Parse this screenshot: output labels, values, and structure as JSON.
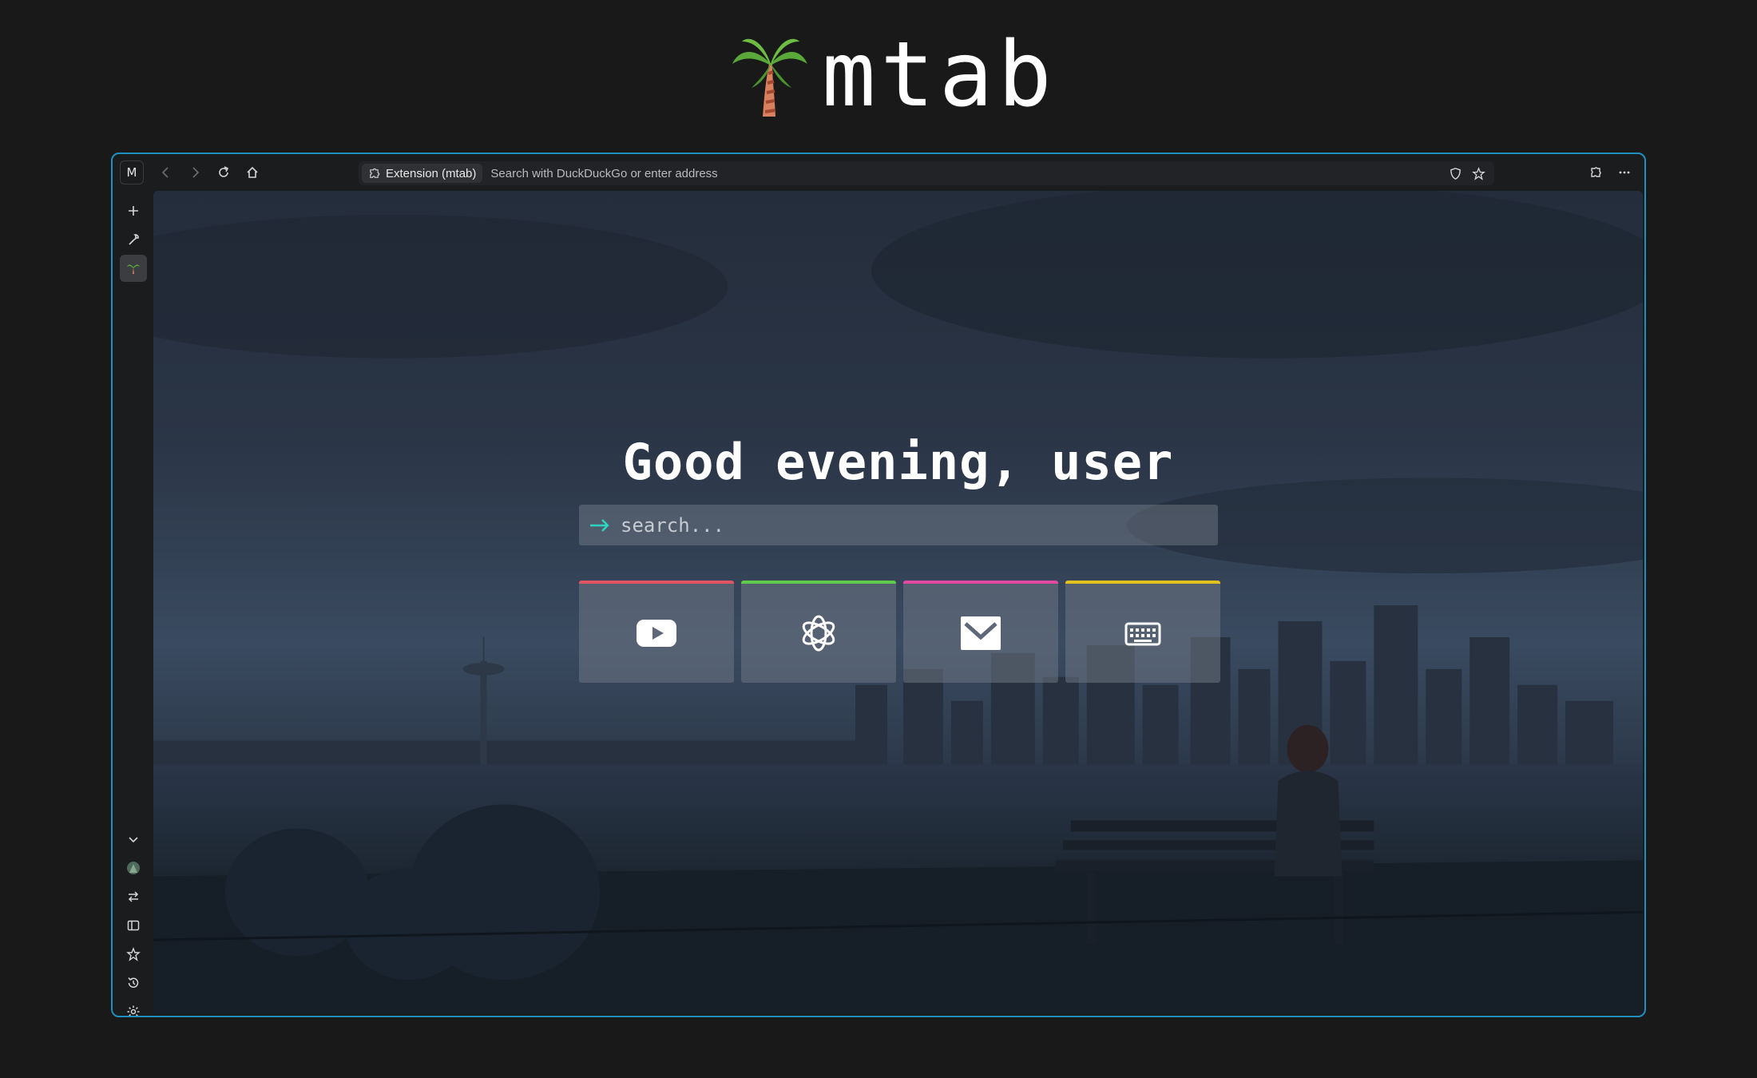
{
  "header": {
    "logo_text": "mtab",
    "logo_icon": "palm-tree-icon"
  },
  "browser": {
    "profile_initial": "M",
    "url_pill_label": "Extension (mtab)",
    "url_placeholder": "Search with DuckDuckGo or enter address"
  },
  "page": {
    "greeting": "Good evening, user",
    "search_placeholder": "search...",
    "tiles": [
      {
        "name": "youtube",
        "icon": "youtube-icon",
        "color": "#e05561"
      },
      {
        "name": "chatgpt",
        "icon": "openai-icon",
        "color": "#5fcb4a"
      },
      {
        "name": "mail",
        "icon": "mail-icon",
        "color": "#e04aa0"
      },
      {
        "name": "keyboard",
        "icon": "keyboard-icon",
        "color": "#e3c21d"
      }
    ]
  },
  "colors": {
    "frame_border": "#1f8fbf",
    "search_arrow": "#2dd4bf",
    "background": "#191919"
  }
}
